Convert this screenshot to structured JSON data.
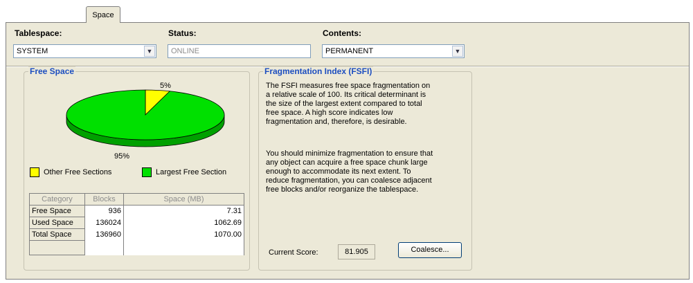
{
  "tab": {
    "label": "Space"
  },
  "fields": {
    "tablespace": {
      "label": "Tablespace:",
      "value": "SYSTEM"
    },
    "status": {
      "label": "Status:",
      "value": "ONLINE"
    },
    "contents": {
      "label": "Contents:",
      "value": "PERMANENT"
    }
  },
  "free_space": {
    "title": "Free Space",
    "pie": {
      "slices": [
        {
          "name": "Other Free Sections",
          "percent": 5,
          "label": "5%",
          "color": "#ffff00"
        },
        {
          "name": "Largest Free Section",
          "percent": 95,
          "label": "95%",
          "color": "#00e000"
        }
      ]
    },
    "legend": [
      {
        "label": "Other Free Sections",
        "color": "#ffff00"
      },
      {
        "label": "Largest Free Section",
        "color": "#00e000"
      }
    ],
    "table": {
      "columns": [
        "Category",
        "Blocks",
        "Space (MB)"
      ],
      "rows": [
        {
          "category": "Free Space",
          "blocks": "936",
          "space": "7.31"
        },
        {
          "category": "Used Space",
          "blocks": "136024",
          "space": "1062.69"
        },
        {
          "category": "Total Space",
          "blocks": "136960",
          "space": "1070.00"
        }
      ]
    }
  },
  "fsfi": {
    "title": "Fragmentation Index (FSFI)",
    "para1": [
      "The FSFI measures free space fragmentation on",
      "a relative scale of 100.  Its critical determinant is",
      "the size of the largest extent compared to total",
      "free space.  A high score indicates low",
      "fragmentation and, therefore, is desirable."
    ],
    "para2": [
      "You should minimize fragmentation to ensure that",
      "any object can acquire a free space chunk large",
      "enough to accommodate its next extent.  To",
      "reduce fragmentation, you can coalesce adjacent",
      "free blocks and/or reorganize the tablespace."
    ],
    "score_label": "Current Score:",
    "score_value": "81.905",
    "coalesce_label": "Coalesce..."
  },
  "colors": {
    "group_title": "#1c4ec0",
    "panel_bg": "#ece9d8",
    "pie_green": "#00e000",
    "pie_green_dark": "#00a000",
    "pie_yellow": "#ffff00"
  }
}
